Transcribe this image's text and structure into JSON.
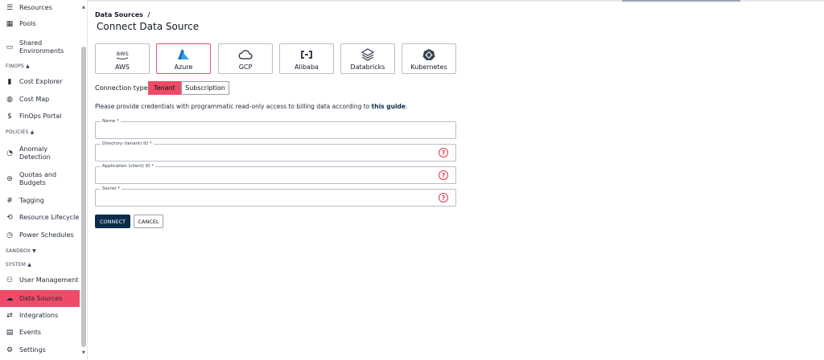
{
  "sidebar": {
    "items": [
      {
        "key": "resources",
        "label": "Resources",
        "icon": "list-icon"
      },
      {
        "key": "pools",
        "label": "Pools",
        "icon": "pools-icon"
      },
      {
        "key": "shared",
        "label": "Shared\nEnvironments",
        "icon": "laptop-icon"
      },
      {
        "key": "cost-explorer",
        "label": "Cost Explorer",
        "icon": "bar-chart-icon"
      },
      {
        "key": "cost-map",
        "label": "Cost Map",
        "icon": "globe-icon"
      },
      {
        "key": "finops-portal",
        "label": "FinOps Portal",
        "icon": "dollar-icon"
      },
      {
        "key": "anomaly",
        "label": "Anomaly\nDetection",
        "icon": "anomaly-icon"
      },
      {
        "key": "quotas",
        "label": "Quotas and\nBudgets",
        "icon": "quota-icon"
      },
      {
        "key": "tagging",
        "label": "Tagging",
        "icon": "hash-icon"
      },
      {
        "key": "lifecycle",
        "label": "Resource Lifecycle",
        "icon": "lifecycle-icon"
      },
      {
        "key": "power",
        "label": "Power Schedules",
        "icon": "clock-icon"
      },
      {
        "key": "users",
        "label": "User Management",
        "icon": "users-icon"
      },
      {
        "key": "data-sources",
        "label": "Data Sources",
        "icon": "cloud-icon",
        "active": true
      },
      {
        "key": "integrations",
        "label": "Integrations",
        "icon": "arrows-icon"
      },
      {
        "key": "events",
        "label": "Events",
        "icon": "calendar-icon"
      },
      {
        "key": "settings",
        "label": "Settings",
        "icon": "gear-icon"
      }
    ],
    "sections": {
      "finops": "FINOPS ▲",
      "policies": "POLICIES ▲",
      "sandbox": "SANDBOX ▼",
      "system": "SYSTEM ▲"
    }
  },
  "header": {
    "breadcrumb": "Data Sources  /",
    "title": "Connect Data Source"
  },
  "providers": [
    {
      "key": "aws",
      "label": "AWS",
      "logo": "aws",
      "selected": false
    },
    {
      "key": "azure",
      "label": "Azure",
      "logo": "azure-icon",
      "selected": true
    },
    {
      "key": "gcp",
      "label": "GCP",
      "logo": "cloud-icon",
      "selected": false
    },
    {
      "key": "alibaba",
      "label": "Alibaba",
      "logo": "alibaba-icon",
      "selected": false
    },
    {
      "key": "databricks",
      "label": "Databricks",
      "logo": "databricks-icon",
      "selected": false
    },
    {
      "key": "kubernetes",
      "label": "Kubernetes",
      "logo": "kubernetes-icon",
      "selected": false
    }
  ],
  "connection_type": {
    "label": "Connection type",
    "options": [
      "Tenant",
      "Subscription"
    ],
    "selected": "Tenant"
  },
  "hint": {
    "text": "Please provide credentials with programmatic read-only access to billing data according to ",
    "link": "this guide",
    "suffix": "."
  },
  "fields": [
    {
      "key": "name",
      "label": "Name *",
      "value": "",
      "help": false
    },
    {
      "key": "tenant",
      "label": "Directory (tenant) ID *",
      "value": "",
      "help": true
    },
    {
      "key": "client",
      "label": "Application (client) ID *",
      "value": "",
      "help": true
    },
    {
      "key": "secret",
      "label": "Secret *",
      "value": "",
      "help": true
    }
  ],
  "actions": {
    "connect": "CONNECT",
    "cancel": "CANCEL"
  },
  "colors": {
    "accent": "#ef4b68",
    "primary": "#0c2c4c",
    "help": "#e8334f"
  }
}
